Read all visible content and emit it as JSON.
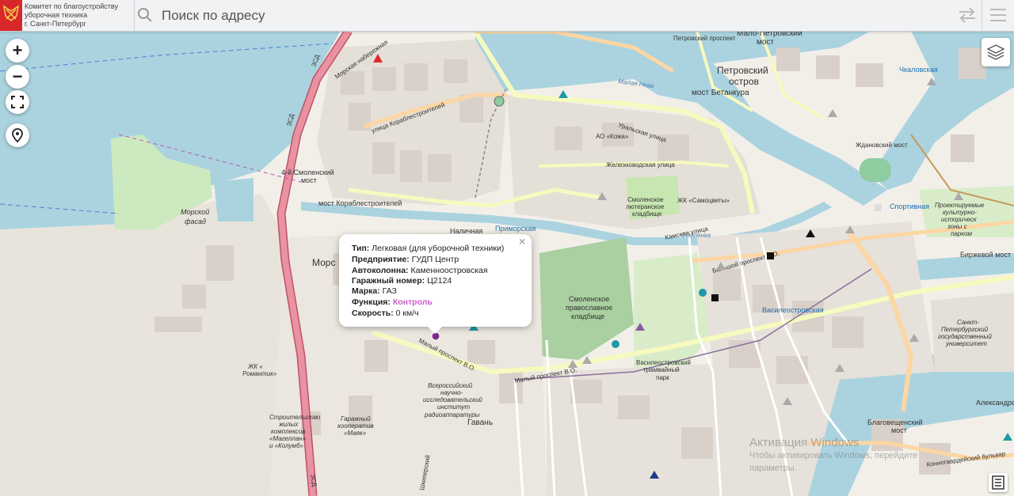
{
  "header": {
    "org_line1": "Комитет по благоустройству",
    "org_line2": "уборочная техника",
    "org_line3": "г. Санкт-Петербург",
    "search_placeholder": "Поиск по адресу"
  },
  "controls": {
    "zoom_in": "+",
    "zoom_out": "−"
  },
  "popup": {
    "close": "×",
    "rows": [
      {
        "label": "Тип:",
        "value": "Легковая (для уборочной техники)"
      },
      {
        "label": "Предприятие:",
        "value": "ГУДП Центр"
      },
      {
        "label": "Автоколонна:",
        "value": "Каменноостровская"
      },
      {
        "label": "Гаражный номер:",
        "value": "Ц2124"
      },
      {
        "label": "Марка:",
        "value": "ГАЗ"
      },
      {
        "label": "Функция:",
        "value": "Контроль"
      },
      {
        "label": "Скорость:",
        "value": "0 км/ч"
      }
    ]
  },
  "map_labels": {
    "malo_petrovsky": "Мало-Петровский",
    "most": "мост",
    "petrovsky_prospekt": "Петровский проспект",
    "petrovsky_ostrov_1": "Петровский",
    "petrovsky_ostrov_2": "остров",
    "most_betankura": "мост Бетанкура",
    "chkalovskaya": "Чкаловская",
    "zhdanovsky_most": "Ждановский мост",
    "uralskaya": "Уральская улица",
    "ao_kozha": "АО «Кожа»",
    "zheleznovodskaya": "Железноводская улица",
    "smolensky_most_4_1": "4-й Смоленский",
    "smolensky_most_4_2": "мост",
    "most_korablestroiteley": "мост Кораблестроителей",
    "ul_korablestroiteley": "улица Кораблестроителей",
    "smolenskoe_kladbische_1": "Смоленское",
    "smolenskoe_kladbische_2": "лютеранское",
    "smolenskoe_kladbische_3": "кладбище",
    "zhk_samotsvety": "ЖК «Самоцветы»",
    "morskoy_fasad_1": "Морской",
    "morskoy_fasad_2": "фасад",
    "nalichnaya": "Наличная",
    "primorskaya": "Приморская",
    "smolenka": "Смоленка",
    "sportivnaya": "Спортивная",
    "smol_prav_1": "Смоленское",
    "smol_prav_2": "православное",
    "smol_prav_3": "кладбище",
    "vasileostrovskaya": "Василеостровская",
    "tram_park_1": "Василеостровский",
    "tram_park_2": "трамвайный",
    "tram_park_3": "парк",
    "morskaya": "Морс",
    "maly_prospekt": "Малый проспект В.О.",
    "vniir_1": "Всероссийский",
    "vniir_2": "научно-",
    "vniir_3": "исследовательский",
    "vniir_4": "институт",
    "vniir_5": "радиоаппаратуры",
    "gavan": "Гавань",
    "zhk_romantik_1": "ЖК «",
    "zhk_romantik_2": "Романтик»",
    "garazh_1": "Гаражный",
    "garazh_2": "кооператив",
    "garazh_3": "«Маяк»",
    "stroit_1": "Строительство",
    "stroit_2": "жилых",
    "stroit_3": "комплексов",
    "stroit_4": "«Магеллан»",
    "stroit_5": "и «Колумб»",
    "blagoveshchensky_1": "Благовещенский",
    "blagoveshchensky_2": "мост",
    "birzhevoy_most": "Биржевой мост",
    "spbgu_1": "Санкт-",
    "spbgu_2": "Петербургский",
    "spbgu_3": "государственный",
    "spbgu_4": "университет",
    "prospekt_1": "Проектируемые",
    "prospekt_2": "культурно-",
    "prospekt_3": "историческ",
    "prospekt_4": "зоны с",
    "prospekt_5": "парком",
    "kamskaya": "Камская улица",
    "malaya_neva": "Малая Нева",
    "bolshoy_prospekt": "Большой проспект В.О.",
    "zsd": "ЗСД",
    "morskaya_nab": "Морская набережная",
    "shkiperskiy": "Шкиперский",
    "konnogvardeysky": "Конногвардейский бульвар",
    "aleksandrovsky": "Александровск",
    "watermark_1": "Активация Windows",
    "watermark_2": "Чтобы активировать Windows, перейдите",
    "watermark_3": "параметры."
  },
  "colors": {
    "water": "#aad3df",
    "land": "#f2efe9",
    "park": "#c8e6b0",
    "cemetery": "#aacfa0",
    "residential": "#e2ddd5",
    "building": "#d9d0c9",
    "motorway": "#e892a2",
    "primary": "#fcd6a4",
    "secondary": "#f7fabf",
    "popup_function": "#d05ad0",
    "marker_red": "#e3262c",
    "marker_teal": "#1f98a8",
    "marker_purple": "#7a2a8a"
  }
}
